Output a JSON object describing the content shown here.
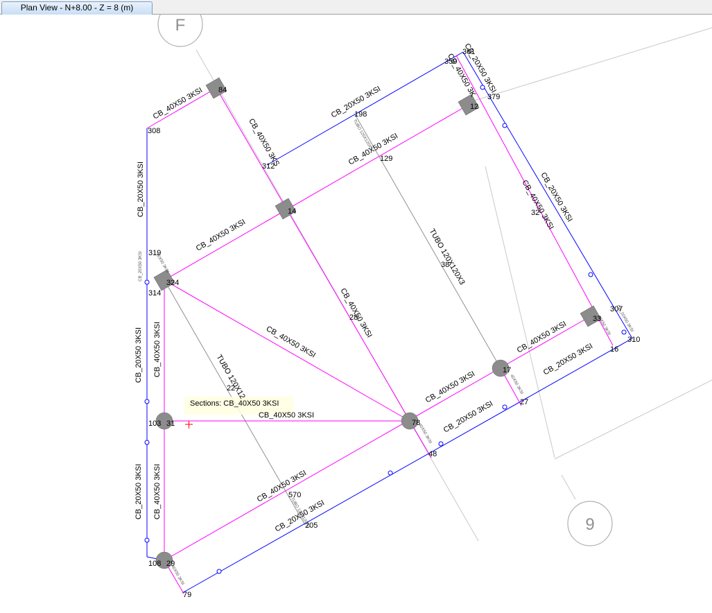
{
  "window": {
    "tab_title": "Plan View - N+8.00 - Z = 8 (m)"
  },
  "grid_bubbles": [
    {
      "label": "F"
    },
    {
      "label": "9"
    }
  ],
  "labels": {
    "cb40": "CB_40X50 3KSI",
    "cb20": "CB_20X50 3KSI",
    "cb40_short": "CB_40X50 3KS",
    "tubo": "TUBO 120X120X3",
    "tubo_short": "TUBO 120X12",
    "tubo_small": "TUBO 120X120X3",
    "cb40_tiny": "40X50 3KSI",
    "cb20_tiny": "CB_20X50 3KSI",
    "cb40_kink": "CB_40X50 3K"
  },
  "nodes": {
    "n308": "308",
    "n319": "319",
    "n314": "314",
    "n324": "324",
    "n84": "84",
    "n350": "350",
    "n361": "361",
    "n379": "379",
    "n12": "12",
    "n198": "198",
    "n312": "312",
    "n14": "14",
    "n129": "129",
    "n32": "32",
    "n307": "307",
    "n33": "33",
    "n310": "310",
    "n16": "16",
    "n38": "38",
    "n28": "28",
    "n22": "22",
    "n27": "27",
    "n78": "78",
    "n103": "103",
    "n31": "31",
    "n570": "570",
    "n205": "205",
    "n108": "108",
    "n29": "29",
    "n79": "79",
    "n18": "18",
    "n48": "48",
    "n17": "17"
  },
  "tooltip": {
    "text": "Sections: CB_40X50 3KSI"
  },
  "colors": {
    "magenta": "#ff00ff",
    "blue": "#0000ff",
    "gray": "#909090"
  }
}
